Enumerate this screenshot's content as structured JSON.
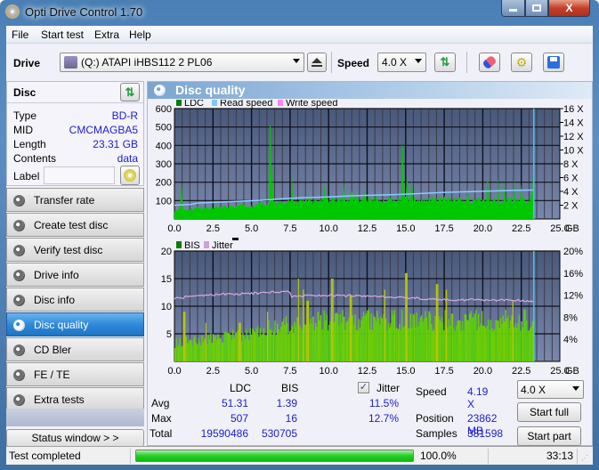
{
  "window": {
    "title": "Opti Drive Control 1.70",
    "min_label": "—",
    "max_label": "▢",
    "close_label": "X"
  },
  "menu": [
    "File",
    "Start test",
    "Extra",
    "Help"
  ],
  "toolbar": {
    "drive_label": "Drive",
    "drive_value": "(Q:)  ATAPI iHBS112   2 PL06",
    "speed_label": "Speed",
    "speed_value": "4.0 X"
  },
  "disc": {
    "header": "Disc",
    "rows": [
      {
        "key": "Type",
        "value": "BD-R"
      },
      {
        "key": "MID",
        "value": "CMCMAGBA5"
      },
      {
        "key": "Length",
        "value": "23.31 GB"
      },
      {
        "key": "Contents",
        "value": "data"
      }
    ],
    "label_key": "Label",
    "label_value": ""
  },
  "nav": [
    {
      "label": "Transfer rate",
      "active": false
    },
    {
      "label": "Create test disc",
      "active": false
    },
    {
      "label": "Verify test disc",
      "active": false
    },
    {
      "label": "Drive info",
      "active": false
    },
    {
      "label": "Disc info",
      "active": false
    },
    {
      "label": "Disc quality",
      "active": true
    },
    {
      "label": "CD Bler",
      "active": false
    },
    {
      "label": "FE / TE",
      "active": false
    },
    {
      "label": "Extra tests",
      "active": false
    }
  ],
  "status_window_label": "Status window > >",
  "panel_title": "Disc quality",
  "chart_data": [
    {
      "type": "bar",
      "title": "LDC",
      "legend": [
        "LDC",
        "Read speed",
        "Write speed"
      ],
      "legend_colors": [
        "#008000",
        "#80c8ff",
        "#ff80ff"
      ],
      "xlabel": "GB",
      "x_ticks": [
        "0.0",
        "2.5",
        "5.0",
        "7.5",
        "10.0",
        "12.5",
        "15.0",
        "17.5",
        "20.0",
        "22.5",
        "25.0"
      ],
      "y_ticks_left": [
        "100",
        "200",
        "300",
        "400",
        "500",
        "600"
      ],
      "y_ticks_right": [
        "2 X",
        "4 X",
        "6 X",
        "8 X",
        "10 X",
        "12 X",
        "14 X",
        "16 X"
      ],
      "xlim": [
        0,
        25
      ],
      "ylim": [
        0,
        600
      ],
      "ylim_right": [
        0,
        16
      ],
      "end_marker_x": 23.31,
      "ldc_base": [
        [
          0,
          55
        ],
        [
          2.5,
          65
        ],
        [
          5,
          75
        ],
        [
          6,
          85
        ],
        [
          7.5,
          100
        ],
        [
          10,
          110
        ],
        [
          12.5,
          115
        ],
        [
          15,
          110
        ],
        [
          17.5,
          110
        ],
        [
          20,
          105
        ],
        [
          23.31,
          110
        ]
      ],
      "ldc_spikes": [
        [
          0.4,
          290
        ],
        [
          0.45,
          180
        ],
        [
          6.2,
          507
        ],
        [
          6.35,
          300
        ],
        [
          7.6,
          260
        ],
        [
          9.7,
          190
        ],
        [
          11.0,
          200
        ],
        [
          11.5,
          150
        ],
        [
          12.3,
          165
        ],
        [
          14.8,
          400
        ],
        [
          15.1,
          230
        ],
        [
          15.4,
          200
        ],
        [
          19.0,
          175
        ],
        [
          20.3,
          215
        ],
        [
          21.0,
          235
        ],
        [
          21.4,
          200
        ],
        [
          22.0,
          220
        ],
        [
          22.5,
          195
        ],
        [
          23.2,
          230
        ]
      ],
      "read_speed": [
        [
          0,
          2.0
        ],
        [
          1,
          2.1
        ],
        [
          1.5,
          2.3
        ],
        [
          2.5,
          2.4
        ],
        [
          3.5,
          2.5
        ],
        [
          4.5,
          2.6
        ],
        [
          5.5,
          2.7
        ],
        [
          6.5,
          2.85
        ],
        [
          7.5,
          3.0
        ],
        [
          8.5,
          3.1
        ],
        [
          10,
          3.2
        ],
        [
          11.5,
          3.35
        ],
        [
          13,
          3.45
        ],
        [
          14.5,
          3.55
        ],
        [
          16,
          3.7
        ],
        [
          17.5,
          3.85
        ],
        [
          19,
          3.95
        ],
        [
          20.5,
          4.05
        ],
        [
          22,
          4.15
        ],
        [
          23.31,
          4.19
        ]
      ]
    },
    {
      "type": "bar",
      "title": "BIS / Jitter",
      "legend": [
        "BIS",
        "Jitter"
      ],
      "legend_colors": [
        "#008000",
        "#d0a0d8"
      ],
      "xlabel": "GB",
      "x_ticks": [
        "0.0",
        "2.5",
        "5.0",
        "7.5",
        "10.0",
        "12.5",
        "15.0",
        "17.5",
        "20.0",
        "22.5",
        "25.0"
      ],
      "y_ticks_left": [
        "5",
        "10",
        "15",
        "20"
      ],
      "y_ticks_right": [
        "4%",
        "8%",
        "12%",
        "16%",
        "20%"
      ],
      "xlim": [
        0,
        25
      ],
      "ylim": [
        0,
        20
      ],
      "ylim_right": [
        0,
        20
      ],
      "end_marker_x": 23.31,
      "bis_base": [
        [
          0,
          4
        ],
        [
          2.5,
          5
        ],
        [
          5,
          6
        ],
        [
          5.5,
          7
        ],
        [
          7.5,
          8
        ],
        [
          10,
          9
        ],
        [
          12.5,
          9
        ],
        [
          15,
          9
        ],
        [
          20,
          9
        ],
        [
          23.31,
          9
        ]
      ],
      "bis_spikes": [
        [
          0.6,
          9
        ],
        [
          2.0,
          7
        ],
        [
          4.2,
          7
        ],
        [
          6.0,
          9
        ],
        [
          8.0,
          15
        ],
        [
          8.3,
          13
        ],
        [
          8.6,
          11
        ],
        [
          10.2,
          15
        ],
        [
          11.4,
          12
        ],
        [
          13.6,
          13
        ],
        [
          15.0,
          16
        ],
        [
          17.0,
          14
        ],
        [
          17.6,
          13
        ],
        [
          21.9,
          11
        ]
      ],
      "jitter": [
        [
          0,
          11.5
        ],
        [
          1,
          11.7
        ],
        [
          2.5,
          12.1
        ],
        [
          5,
          12.3
        ],
        [
          7.4,
          12.7
        ],
        [
          7.6,
          11.8
        ],
        [
          10,
          12.0
        ],
        [
          12.5,
          11.8
        ],
        [
          15,
          11.5
        ],
        [
          17.5,
          11.2
        ],
        [
          20,
          11.1
        ],
        [
          23.31,
          11.0
        ]
      ]
    }
  ],
  "stats": {
    "col_ldc": "LDC",
    "col_bis": "BIS",
    "jitter_checked": true,
    "jitter_label": "Jitter",
    "rows": [
      {
        "label": "Avg",
        "ldc": "51.31",
        "bis": "1.39",
        "jitter": "11.5%"
      },
      {
        "label": "Max",
        "ldc": "507",
        "bis": "16",
        "jitter": "12.7%"
      },
      {
        "label": "Total",
        "ldc": "19590486",
        "bis": "530705",
        "jitter": ""
      }
    ],
    "speed_label": "Speed",
    "speed_value": "4.19 X",
    "position_label": "Position",
    "position_value": "23862 MB",
    "samples_label": "Samples",
    "samples_value": "381598",
    "speed_select": "4.0 X",
    "start_full": "Start full",
    "start_part": "Start part"
  },
  "statusbar": {
    "text": "Test completed",
    "progress": 100.0,
    "progress_label": "100.0%",
    "time": "33:13"
  }
}
